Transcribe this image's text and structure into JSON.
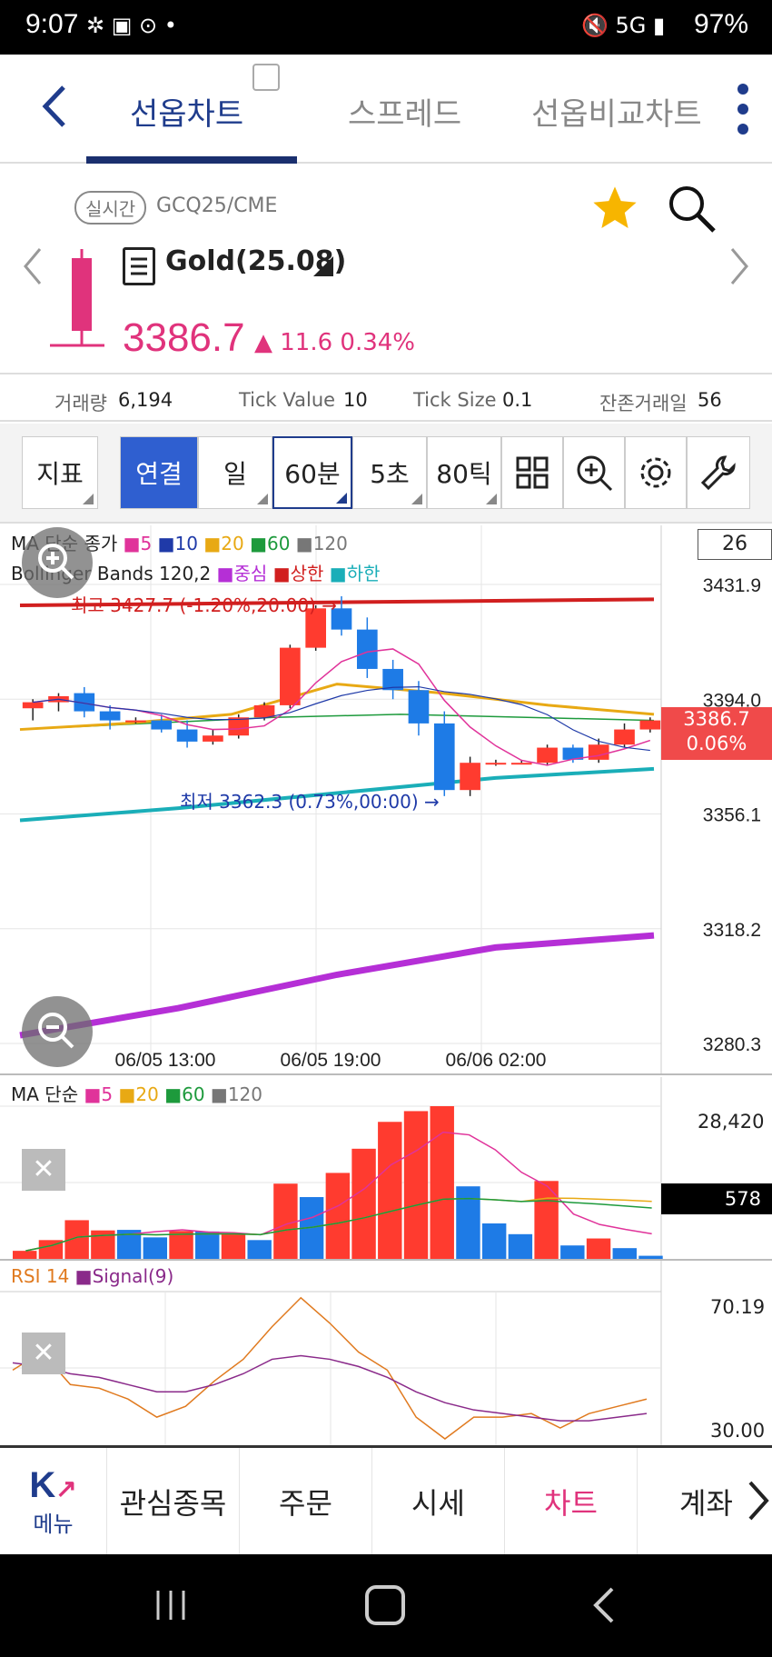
{
  "status": {
    "time": "9:07",
    "battery": "97%"
  },
  "tabs": [
    {
      "label": "선옵차트",
      "active": true
    },
    {
      "label": "스프레드",
      "active": false
    },
    {
      "label": "선옵비교차트",
      "active": false
    }
  ],
  "symbol": {
    "realtime_chip": "실시간",
    "code": "GCQ25/CME",
    "name": "Gold(25.08)",
    "price": "3386.7",
    "change": "▲ 11.6 0.34%"
  },
  "info": {
    "volume_label": "거래량",
    "volume": "6,194",
    "tick_value_label": "Tick Value",
    "tick_value": "10",
    "tick_size_label": "Tick Size",
    "tick_size": "0.1",
    "days_label": "잔존거래일",
    "days": "56"
  },
  "toolbar": {
    "indicator": "지표",
    "connect": "연결",
    "day": "일",
    "min60": "60분",
    "sec5": "5초",
    "tick80": "80틱"
  },
  "main_chart": {
    "legend_ma_title": "MA 단순 종가",
    "legend_bb": "Bollinger Bands 120,2",
    "bb_center": "중심",
    "bb_upper": "상한",
    "bb_lower": "하한",
    "ma_periods": [
      "5",
      "10",
      "20",
      "60",
      "120"
    ],
    "count_box": "26",
    "high_label": "최고 3427.7 (-1.20%,20:00) →",
    "low_label": "최저 3362.3 (0.73%,00:00) →",
    "current_price": "3386.7",
    "current_pct": "0.06%",
    "colors": {
      "ma5": "#e0339a",
      "ma10": "#1f3aa8",
      "ma20": "#e8a914",
      "ma60": "#1d9a3c",
      "ma120": "#777777",
      "bb_upper": "#d11f1f",
      "bb_center": "#b52fd6",
      "bb_lower": "#1aaeb8",
      "up": "#ff3b2f",
      "down": "#1e7be6"
    }
  },
  "volume_chart": {
    "legend_title": "MA 단순",
    "periods": [
      "5",
      "20",
      "60",
      "120"
    ],
    "max_label": "28,420",
    "current_label": "578"
  },
  "rsi_chart": {
    "label_rsi": "RSI 14",
    "label_signal": "Signal(9)",
    "top_label": "70.19",
    "bottom_label": "30.00"
  },
  "chart_data": [
    {
      "type": "candlestick",
      "y_ticks": [
        "3431.9",
        "3394.0",
        "3356.1",
        "3318.2",
        "3280.3"
      ],
      "ylim": [
        3280.3,
        3431.9
      ],
      "x_tick_labels": [
        "06/05 13:00",
        "06/05 19:00",
        "06/06 02:00"
      ],
      "candles": [
        {
          "o": 3391,
          "h": 3394,
          "l": 3387,
          "c": 3393
        },
        {
          "o": 3393,
          "h": 3396,
          "l": 3390,
          "c": 3395
        },
        {
          "o": 3396,
          "h": 3398,
          "l": 3388,
          "c": 3390
        },
        {
          "o": 3390,
          "h": 3392,
          "l": 3384,
          "c": 3387
        },
        {
          "o": 3387,
          "h": 3388,
          "l": 3386,
          "c": 3387
        },
        {
          "o": 3387,
          "h": 3389,
          "l": 3383,
          "c": 3384
        },
        {
          "o": 3384,
          "h": 3387,
          "l": 3378,
          "c": 3380
        },
        {
          "o": 3380,
          "h": 3384,
          "l": 3379,
          "c": 3382
        },
        {
          "o": 3382,
          "h": 3389,
          "l": 3381,
          "c": 3388
        },
        {
          "o": 3388,
          "h": 3393,
          "l": 3387,
          "c": 3392
        },
        {
          "o": 3392,
          "h": 3412,
          "l": 3391,
          "c": 3411
        },
        {
          "o": 3411,
          "h": 3425,
          "l": 3410,
          "c": 3424
        },
        {
          "o": 3424,
          "h": 3428,
          "l": 3415,
          "c": 3417
        },
        {
          "o": 3417,
          "h": 3421,
          "l": 3401,
          "c": 3404
        },
        {
          "o": 3404,
          "h": 3407,
          "l": 3394,
          "c": 3397
        },
        {
          "o": 3397,
          "h": 3400,
          "l": 3382,
          "c": 3386
        },
        {
          "o": 3386,
          "h": 3390,
          "l": 3362,
          "c": 3364
        },
        {
          "o": 3364,
          "h": 3375,
          "l": 3362,
          "c": 3373
        },
        {
          "o": 3373,
          "h": 3374,
          "l": 3372,
          "c": 3373
        },
        {
          "o": 3373,
          "h": 3374,
          "l": 3373,
          "c": 3373
        },
        {
          "o": 3373,
          "h": 3379,
          "l": 3372,
          "c": 3378
        },
        {
          "o": 3378,
          "h": 3379,
          "l": 3373,
          "c": 3374
        },
        {
          "o": 3374,
          "h": 3381,
          "l": 3373,
          "c": 3379
        },
        {
          "o": 3379,
          "h": 3386,
          "l": 3378,
          "c": 3384
        },
        {
          "o": 3384,
          "h": 3388,
          "l": 3383,
          "c": 3387
        }
      ],
      "bb_upper": [
        3425,
        3425.5,
        3426,
        3426.5,
        3427
      ],
      "bb_center": [
        3354,
        3358,
        3363,
        3368,
        3371
      ],
      "bb_lower": [
        3283,
        3292,
        3303,
        3312,
        3316
      ],
      "ma20": [
        3384,
        3386,
        3389,
        3399,
        3396,
        3392,
        3389
      ],
      "ma60": [
        3384,
        3386,
        3388,
        3389,
        3388,
        3387
      ]
    },
    {
      "type": "bar",
      "title": "volume",
      "ylim": [
        0,
        28420
      ],
      "values": [
        1500,
        3500,
        7200,
        5300,
        5400,
        4000,
        5200,
        5100,
        4600,
        3500,
        14000,
        11500,
        16000,
        20500,
        25500,
        27500,
        28420,
        13500,
        6600,
        4600,
        14500,
        2500,
        3800,
        2000,
        578
      ],
      "up": [
        true,
        true,
        true,
        true,
        false,
        false,
        true,
        false,
        true,
        false,
        true,
        false,
        true,
        true,
        true,
        true,
        true,
        false,
        false,
        false,
        true,
        false,
        true,
        false,
        false
      ]
    },
    {
      "type": "line",
      "title": "RSI",
      "ylim": [
        30,
        70.19
      ],
      "series": [
        {
          "name": "RSI 14",
          "values": [
            50,
            55,
            46,
            45,
            42,
            37,
            40,
            47,
            53,
            62,
            70,
            63,
            55,
            50,
            37,
            31,
            37,
            37,
            38,
            34,
            38,
            40,
            42
          ]
        },
        {
          "name": "Signal(9)",
          "values": [
            52,
            51,
            49,
            48,
            46,
            44,
            44,
            46,
            49,
            53,
            54,
            53,
            51,
            48,
            44,
            41,
            39,
            38,
            37,
            36,
            36,
            37,
            38
          ]
        }
      ]
    }
  ]
}
